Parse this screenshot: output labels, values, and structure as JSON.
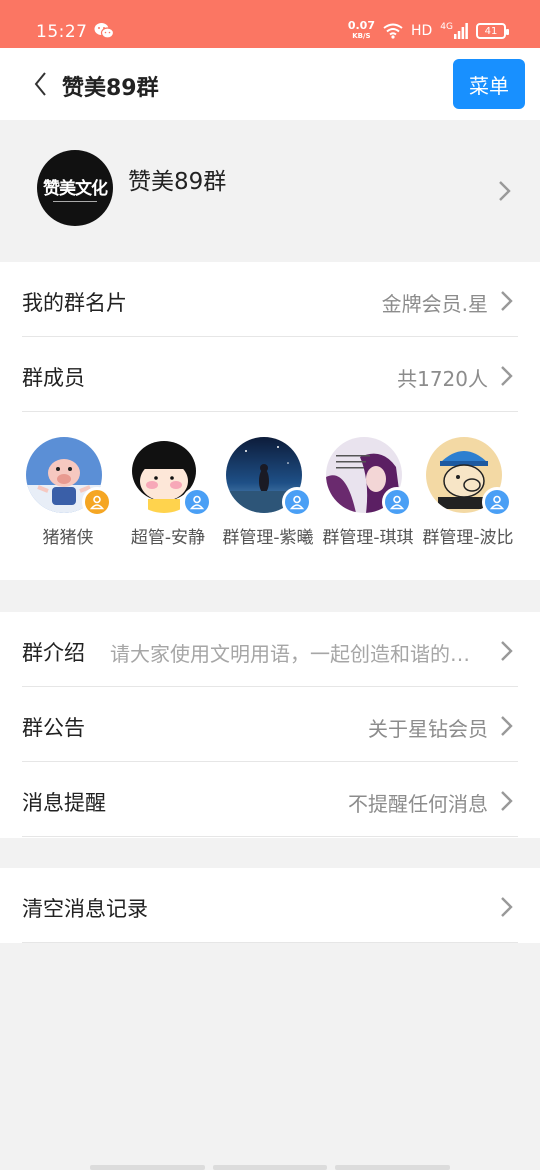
{
  "status_bar": {
    "time": "15:27",
    "net_speed": "0.07",
    "net_unit": "KB/S",
    "hd": "HD",
    "signal": "4G",
    "battery": "41"
  },
  "header": {
    "title": "赞美89群",
    "menu_label": "菜单"
  },
  "group": {
    "name": "赞美89群",
    "logo_text": "赞美文化"
  },
  "rows_top": {
    "card_name_label": "我的群名片",
    "card_name_value": "金牌会员.星",
    "members_label": "群成员",
    "members_value": "共1720人"
  },
  "members": [
    {
      "name": "猪猪侠",
      "role": "owner"
    },
    {
      "name": "超管-安静",
      "role": "admin"
    },
    {
      "name": "群管理-紫曦",
      "role": "admin"
    },
    {
      "name": "群管理-琪琪",
      "role": "admin"
    },
    {
      "name": "群管理-波比",
      "role": "admin"
    }
  ],
  "rows_mid": {
    "intro_label": "群介绍",
    "intro_value": "请大家使用文明用语，一起创造和谐的群聊环境",
    "notice_label": "群公告",
    "notice_value": "关于星钻会员",
    "remind_label": "消息提醒",
    "remind_value": "不提醒任何消息"
  },
  "rows_bottom": {
    "clear_label": "清空消息记录"
  },
  "colors": {
    "status_bar": "#fb7663",
    "accent": "#1890ff",
    "owner_badge": "#f5a623",
    "admin_badge": "#4a9ff5"
  }
}
